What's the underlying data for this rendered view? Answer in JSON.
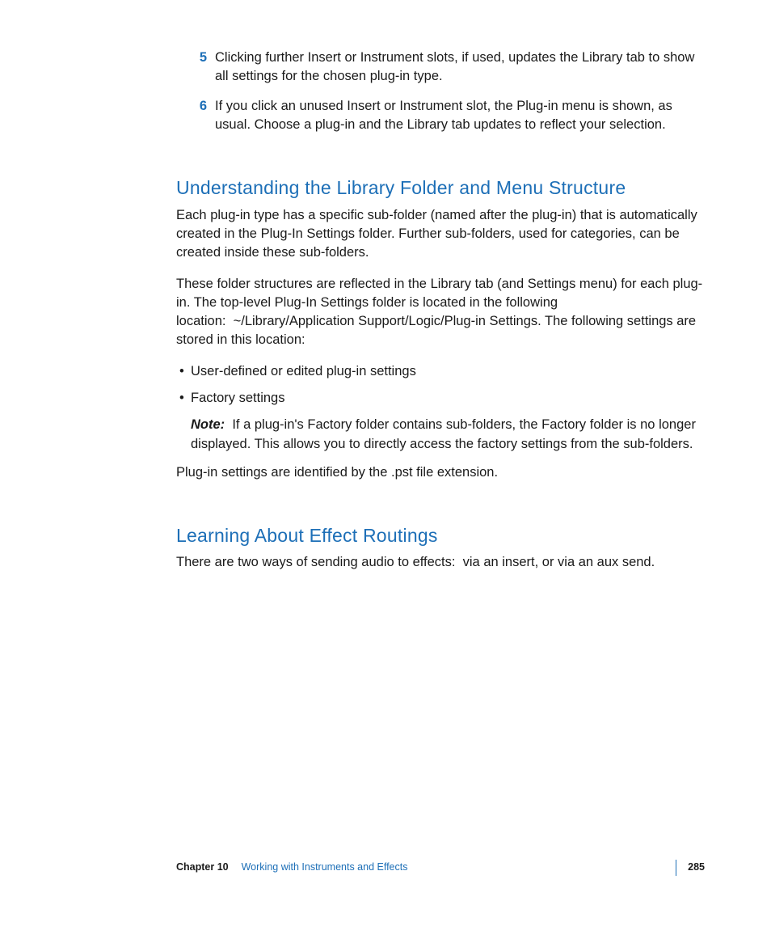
{
  "steps": [
    {
      "num": "5",
      "text": "Clicking further Insert or Instrument slots, if used, updates the Library tab to show all settings for the chosen plug-in type."
    },
    {
      "num": "6",
      "text": "If you click an unused Insert or Instrument slot, the Plug-in menu is shown, as usual. Choose a plug-in and the Library tab updates to reflect your selection."
    }
  ],
  "section1": {
    "heading": "Understanding the Library Folder and Menu Structure",
    "para1": "Each plug-in type has a specific sub-folder (named after the plug-in) that is automatically created in the Plug-In Settings folder. Further sub-folders, used for categories, can be created inside these sub-folders.",
    "para2": "These folder structures are reflected in the Library tab (and Settings menu) for each plug-in. The top-level Plug-In Settings folder is located in the following location:  ~/Library/Application Support/Logic/Plug-in Settings. The following settings are stored in this location:",
    "bullets": [
      "User-defined or edited plug-in settings",
      "Factory settings"
    ],
    "note_label": "Note:",
    "note_text": "  If a plug-in's Factory folder contains sub-folders, the Factory folder is no longer displayed. This allows you to directly access the factory settings from the sub-folders.",
    "para3": "Plug-in settings are identified by the .pst file extension."
  },
  "section2": {
    "heading": "Learning About Effect Routings",
    "para1": "There are two ways of sending audio to effects:  via an insert, or via an aux send."
  },
  "footer": {
    "chapter": "Chapter 10",
    "title": "Working with Instruments and Effects",
    "page": "285"
  }
}
